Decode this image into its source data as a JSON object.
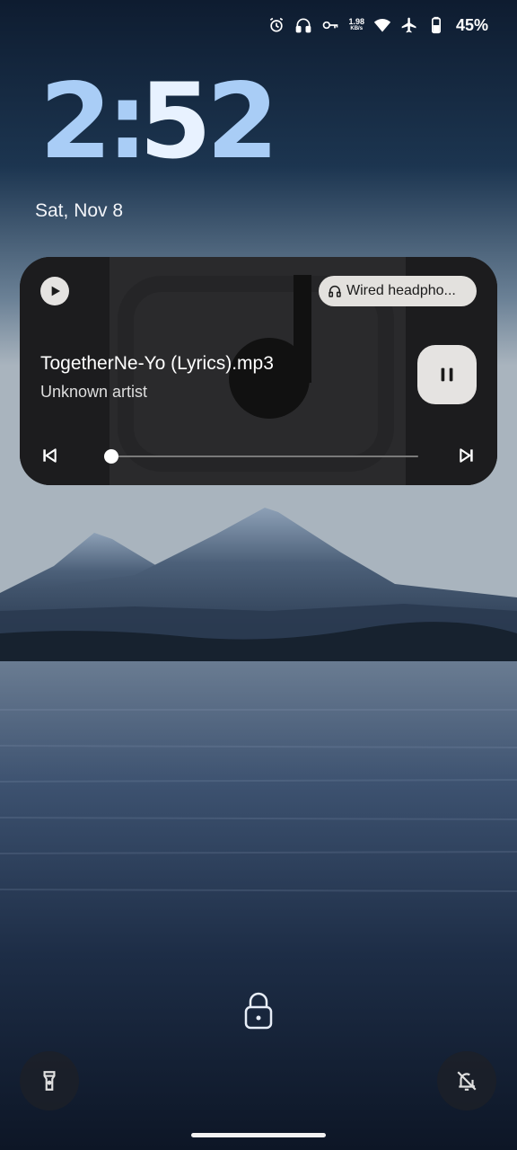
{
  "status_bar": {
    "icons": [
      "alarm-icon",
      "headphones-icon",
      "vpn-key-icon",
      "wifi-icon",
      "airplane-icon",
      "battery-icon"
    ],
    "net_speed_value": "1.98",
    "net_speed_unit": "KB/s",
    "battery_percent": "45%"
  },
  "lockscreen": {
    "clock": {
      "h": "2",
      "sep": ":",
      "m1": "5",
      "m2": "2"
    },
    "date": "Sat, Nov 8"
  },
  "media": {
    "output_device": "Wired headpho...",
    "title": "TogetherNe-Yo (Lyrics).mp3",
    "artist": "Unknown artist",
    "progress": 0.02,
    "icons": {
      "app": "play-icon",
      "output": "headphones-icon",
      "pause": "pause-icon",
      "prev": "skip-previous-icon",
      "next": "skip-next-icon"
    }
  },
  "bottom": {
    "left_shortcut": "flashlight-icon",
    "center": "lock-icon",
    "right_shortcut": "notifications-off-icon"
  },
  "colors": {
    "clock": "#a9cdf6",
    "card_bg": "#1b1b1d",
    "chip_bg": "#e3e1de"
  }
}
